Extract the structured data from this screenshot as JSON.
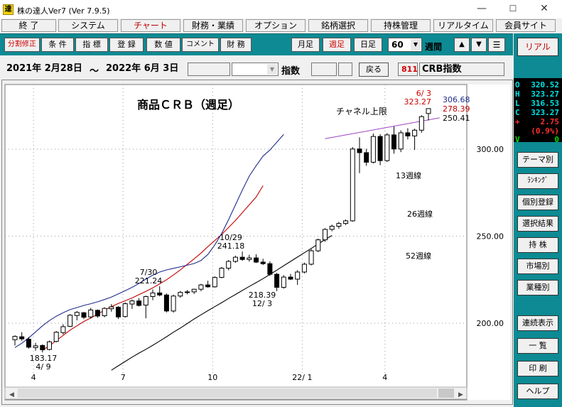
{
  "window": {
    "title": "株の達人Ver7 (Ver 7.9.5)",
    "icon_glyph": "達"
  },
  "menu": [
    "終 了",
    "システム",
    "チャート",
    "財務・業績",
    "オプション",
    "銘柄選択",
    "持株管理",
    "リアルタイム",
    "会員サイト"
  ],
  "toolbar": {
    "left": [
      "分割修正",
      "条 件",
      "指 標",
      "登 録",
      "数 値",
      "コメント",
      "財 務"
    ],
    "periods": [
      "月足",
      "週足",
      "日足"
    ],
    "count": "60",
    "count_unit": "週間",
    "arrow_up": "▲",
    "arrow_down": "▼",
    "menu_icon": "☰"
  },
  "daterow": {
    "start_date": "2021年 2月28日",
    "tilde": "～",
    "end_date": "2022年 6月 3日",
    "index_label": "指数",
    "back_button": "戻る",
    "code": "811",
    "symbol_name": "CRB指数"
  },
  "sidebar": {
    "realtime": "リアル",
    "ohlc": [
      {
        "k": "O",
        "v": "320.52"
      },
      {
        "k": "H",
        "v": "323.27"
      },
      {
        "k": "L",
        "v": "316.53"
      },
      {
        "k": "C",
        "v": "323.27"
      },
      {
        "k": "+",
        "v": "2.75"
      },
      {
        "k": "",
        "v": "(0.9%)"
      },
      {
        "k": "V",
        "v": "0"
      }
    ],
    "buttons": [
      "テーマ別",
      "ﾗﾝｷﾝｸﾞ",
      "個別登録",
      "選択結果",
      "持 株",
      "市場別",
      "業種別",
      "連続表示",
      "一 覧",
      "印 刷",
      "ヘルプ"
    ]
  },
  "chart_data": {
    "type": "candlestick",
    "title": "商品ＣＲＢ（週足）",
    "y_tick_labels": [
      "300.00",
      "250.00",
      "200.00"
    ],
    "ylim": [
      184,
      322
    ],
    "x_tick_labels": [
      "4",
      "7",
      "10",
      "22/ 1",
      "4"
    ],
    "annotations": [
      {
        "label": "183.17",
        "sub": "4/ 9"
      },
      {
        "label": "221.24",
        "sub": "7/30"
      },
      {
        "label": "241.18",
        "sub": "10/29"
      },
      {
        "label": "218.39",
        "sub": "12/ 3"
      },
      {
        "label": "323.27",
        "sub": "6/ 3"
      },
      {
        "label": "チャネル上限"
      },
      {
        "label": "13週線"
      },
      {
        "label": "26週線"
      },
      {
        "label": "52週線"
      }
    ],
    "price_labels": [
      "306.68",
      "278.39",
      "250.41"
    ],
    "candles": [
      {
        "o": 190.5,
        "h": 193.0,
        "l": 187.2,
        "c": 192.4
      },
      {
        "o": 192.2,
        "h": 194.8,
        "l": 189.9,
        "c": 191.0
      },
      {
        "o": 190.8,
        "h": 192.0,
        "l": 185.4,
        "c": 186.2
      },
      {
        "o": 186.0,
        "h": 188.7,
        "l": 184.2,
        "c": 187.0
      },
      {
        "o": 187.2,
        "h": 187.8,
        "l": 183.2,
        "c": 184.7
      },
      {
        "o": 184.9,
        "h": 190.0,
        "l": 184.4,
        "c": 189.3
      },
      {
        "o": 189.5,
        "h": 195.5,
        "l": 189.0,
        "c": 194.8
      },
      {
        "o": 194.6,
        "h": 199.4,
        "l": 193.5,
        "c": 198.0
      },
      {
        "o": 198.2,
        "h": 205.2,
        "l": 197.8,
        "c": 204.6
      },
      {
        "o": 204.4,
        "h": 207.0,
        "l": 201.6,
        "c": 206.2
      },
      {
        "o": 206.0,
        "h": 206.5,
        "l": 202.4,
        "c": 203.4
      },
      {
        "o": 203.6,
        "h": 208.8,
        "l": 202.6,
        "c": 207.6
      },
      {
        "o": 207.4,
        "h": 207.9,
        "l": 203.1,
        "c": 204.1
      },
      {
        "o": 204.3,
        "h": 209.2,
        "l": 203.4,
        "c": 208.5
      },
      {
        "o": 208.3,
        "h": 211.0,
        "l": 206.6,
        "c": 209.4
      },
      {
        "o": 209.2,
        "h": 209.8,
        "l": 202.4,
        "c": 203.6
      },
      {
        "o": 203.8,
        "h": 212.0,
        "l": 203.2,
        "c": 211.2
      },
      {
        "o": 211.0,
        "h": 213.6,
        "l": 208.2,
        "c": 212.8
      },
      {
        "o": 212.8,
        "h": 214.4,
        "l": 209.6,
        "c": 210.2
      },
      {
        "o": 210.4,
        "h": 215.8,
        "l": 202.8,
        "c": 215.3
      },
      {
        "o": 215.3,
        "h": 219.4,
        "l": 213.2,
        "c": 217.4
      },
      {
        "o": 217.4,
        "h": 221.2,
        "l": 215.4,
        "c": 216.2
      },
      {
        "o": 216.2,
        "h": 217.1,
        "l": 206.2,
        "c": 207.0
      },
      {
        "o": 207.0,
        "h": 216.4,
        "l": 206.1,
        "c": 215.6
      },
      {
        "o": 215.6,
        "h": 218.5,
        "l": 214.6,
        "c": 217.7
      },
      {
        "o": 217.7,
        "h": 219.0,
        "l": 216.6,
        "c": 218.0
      },
      {
        "o": 218.0,
        "h": 219.8,
        "l": 216.8,
        "c": 219.5
      },
      {
        "o": 219.5,
        "h": 222.6,
        "l": 218.4,
        "c": 222.0
      },
      {
        "o": 222.0,
        "h": 224.4,
        "l": 220.4,
        "c": 220.9
      },
      {
        "o": 220.9,
        "h": 226.9,
        "l": 220.4,
        "c": 226.3
      },
      {
        "o": 226.3,
        "h": 232.3,
        "l": 225.8,
        "c": 231.6
      },
      {
        "o": 231.6,
        "h": 236.3,
        "l": 230.4,
        "c": 235.5
      },
      {
        "o": 235.5,
        "h": 238.8,
        "l": 234.7,
        "c": 237.9
      },
      {
        "o": 237.9,
        "h": 241.2,
        "l": 235.8,
        "c": 236.6
      },
      {
        "o": 236.6,
        "h": 239.3,
        "l": 235.4,
        "c": 237.5
      },
      {
        "o": 237.5,
        "h": 239.6,
        "l": 234.6,
        "c": 235.1
      },
      {
        "o": 235.1,
        "h": 237.0,
        "l": 233.4,
        "c": 234.2
      },
      {
        "o": 234.2,
        "h": 235.5,
        "l": 227.2,
        "c": 228.1
      },
      {
        "o": 228.1,
        "h": 228.9,
        "l": 218.4,
        "c": 220.6
      },
      {
        "o": 220.6,
        "h": 227.6,
        "l": 219.8,
        "c": 226.5
      },
      {
        "o": 226.5,
        "h": 228.3,
        "l": 224.8,
        "c": 225.3
      },
      {
        "o": 225.3,
        "h": 230.5,
        "l": 222.0,
        "c": 229.4
      },
      {
        "o": 229.4,
        "h": 234.8,
        "l": 228.6,
        "c": 233.9
      },
      {
        "o": 233.9,
        "h": 242.6,
        "l": 233.2,
        "c": 241.6
      },
      {
        "o": 241.6,
        "h": 248.6,
        "l": 240.8,
        "c": 247.9
      },
      {
        "o": 247.9,
        "h": 254.6,
        "l": 246.8,
        "c": 253.9
      },
      {
        "o": 253.9,
        "h": 256.6,
        "l": 252.8,
        "c": 255.7
      },
      {
        "o": 255.7,
        "h": 258.2,
        "l": 254.3,
        "c": 257.3
      },
      {
        "o": 257.3,
        "h": 259.6,
        "l": 256.4,
        "c": 258.8
      },
      {
        "o": 258.8,
        "h": 301.2,
        "l": 258.3,
        "c": 300.1
      },
      {
        "o": 300.1,
        "h": 306.8,
        "l": 286.2,
        "c": 298.0
      },
      {
        "o": 298.0,
        "h": 300.2,
        "l": 290.4,
        "c": 292.5
      },
      {
        "o": 292.5,
        "h": 309.0,
        "l": 291.8,
        "c": 307.3
      },
      {
        "o": 307.3,
        "h": 308.6,
        "l": 290.8,
        "c": 293.4
      },
      {
        "o": 293.4,
        "h": 309.2,
        "l": 292.6,
        "c": 308.2
      },
      {
        "o": 308.2,
        "h": 313.0,
        "l": 297.4,
        "c": 300.1
      },
      {
        "o": 300.1,
        "h": 310.8,
        "l": 298.3,
        "c": 309.4
      },
      {
        "o": 309.4,
        "h": 312.0,
        "l": 305.6,
        "c": 307.6
      },
      {
        "o": 307.6,
        "h": 311.8,
        "l": 299.6,
        "c": 310.9
      },
      {
        "o": 310.9,
        "h": 319.5,
        "l": 309.4,
        "c": 318.7
      },
      {
        "o": 320.5,
        "h": 323.3,
        "l": 316.5,
        "c": 323.3
      }
    ],
    "series": [
      {
        "name": "13週線",
        "color": "#1f2d8c",
        "values": [
          186.0,
          188.5,
          191.5,
          195.0,
          198.5,
          201.5,
          204.0,
          206.0,
          207.8,
          209.0,
          210.2,
          211.2,
          212.3,
          213.6,
          215.0,
          216.8,
          218.7,
          220.6,
          222.8,
          225.3,
          227.6,
          229.4,
          230.6,
          231.5,
          232.4,
          233.3,
          234.3,
          236.0,
          239.5,
          245.0,
          251.5,
          259.5,
          268.0,
          276.5,
          284.5,
          290.5,
          296.0,
          299.5,
          304.0,
          308.5
        ]
      },
      {
        "name": "26週線",
        "color": "#c00000",
        "values": [
          184.5,
          187.0,
          190.0,
          193.0,
          196.0,
          198.5,
          201.0,
          203.0,
          205.2,
          207.5,
          209.5,
          211.3,
          212.9,
          214.5,
          216.4,
          218.3,
          220.3,
          222.6,
          225.0,
          227.7,
          230.6,
          233.8,
          237.0,
          240.3,
          244.0,
          247.5,
          251.0,
          255.0,
          259.0,
          263.5,
          268.0,
          272.5,
          279.0
        ]
      },
      {
        "name": "52週線",
        "color": "#000000",
        "values": [
          173.0,
          175.5,
          178.0,
          180.5,
          182.8,
          185.0,
          187.3,
          189.7,
          192.2,
          194.8,
          197.2,
          199.8,
          202.4,
          204.8,
          207.2,
          209.5,
          211.8,
          214.2,
          216.5,
          218.8,
          221.1,
          223.3,
          225.6,
          228.0,
          230.5,
          233.0,
          235.5,
          238.0,
          240.5,
          243.0,
          245.5,
          248.0,
          250.4
        ]
      }
    ],
    "channel_upper": {
      "name": "チャネル上限",
      "color": "#a040c0",
      "from": 306.0,
      "to": 318.0
    }
  }
}
